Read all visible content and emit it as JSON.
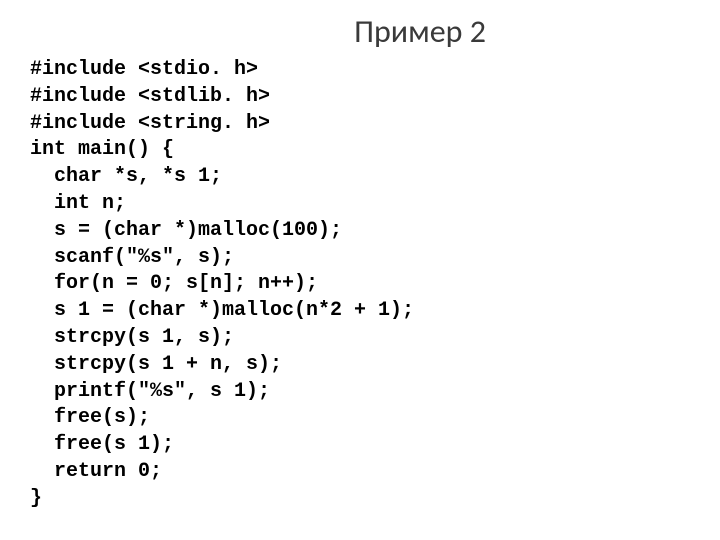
{
  "title": "Пример 2",
  "code_lines": [
    "#include <stdio. h>",
    "#include <stdlib. h>",
    "#include <string. h>",
    "int main() {",
    "  char *s, *s 1;",
    "  int n;",
    "  s = (char *)malloc(100);",
    "  scanf(\"%s\", s);",
    "  for(n = 0; s[n]; n++);",
    "  s 1 = (char *)malloc(n*2 + 1);",
    "  strcpy(s 1, s);",
    "  strcpy(s 1 + n, s);",
    "  printf(\"%s\", s 1);",
    "  free(s);",
    "  free(s 1);",
    "  return 0;",
    "}"
  ]
}
